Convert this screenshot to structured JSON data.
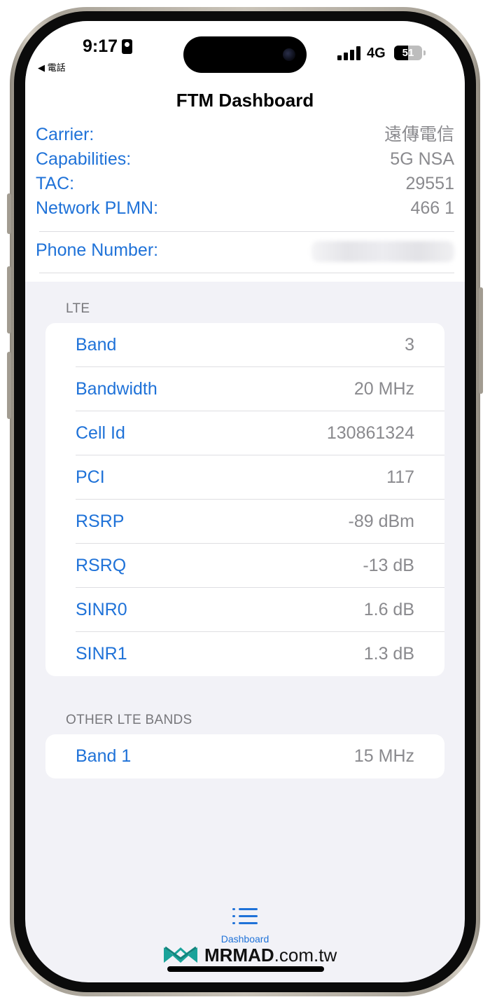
{
  "status_bar": {
    "time": "9:17",
    "back_app": "◀ 電話",
    "network": "4G",
    "battery": "51",
    "battery_percent": 51
  },
  "nav": {
    "title": "FTM Dashboard"
  },
  "info": [
    {
      "label": "Carrier:",
      "value": "遠傳電信"
    },
    {
      "label": "Capabilities:",
      "value": "5G NSA"
    },
    {
      "label": "TAC:",
      "value": "29551"
    },
    {
      "label": "Network PLMN:",
      "value": "466 1"
    }
  ],
  "phone": {
    "label": "Phone Number:"
  },
  "lte": {
    "header": "LTE",
    "rows": [
      {
        "label": "Band",
        "value": "3"
      },
      {
        "label": "Bandwidth",
        "value": "20 MHz"
      },
      {
        "label": "Cell Id",
        "value": "130861324"
      },
      {
        "label": "PCI",
        "value": "117"
      },
      {
        "label": "RSRP",
        "value": "-89 dBm"
      },
      {
        "label": "RSRQ",
        "value": "-13 dB"
      },
      {
        "label": "SINR0",
        "value": "1.6 dB"
      },
      {
        "label": "SINR1",
        "value": "1.3 dB"
      }
    ]
  },
  "other": {
    "header": "OTHER LTE BANDS",
    "rows": [
      {
        "label": "Band 1",
        "value": "15 MHz"
      }
    ]
  },
  "tab_bar": {
    "label": "Dashboard",
    "icon": "list-icon"
  },
  "watermark": {
    "brand": "MRMAD",
    "suffix": ".com.tw"
  },
  "colors": {
    "accent": "#1f72d8",
    "value": "#8a8a8e",
    "background": "#f2f2f7"
  }
}
